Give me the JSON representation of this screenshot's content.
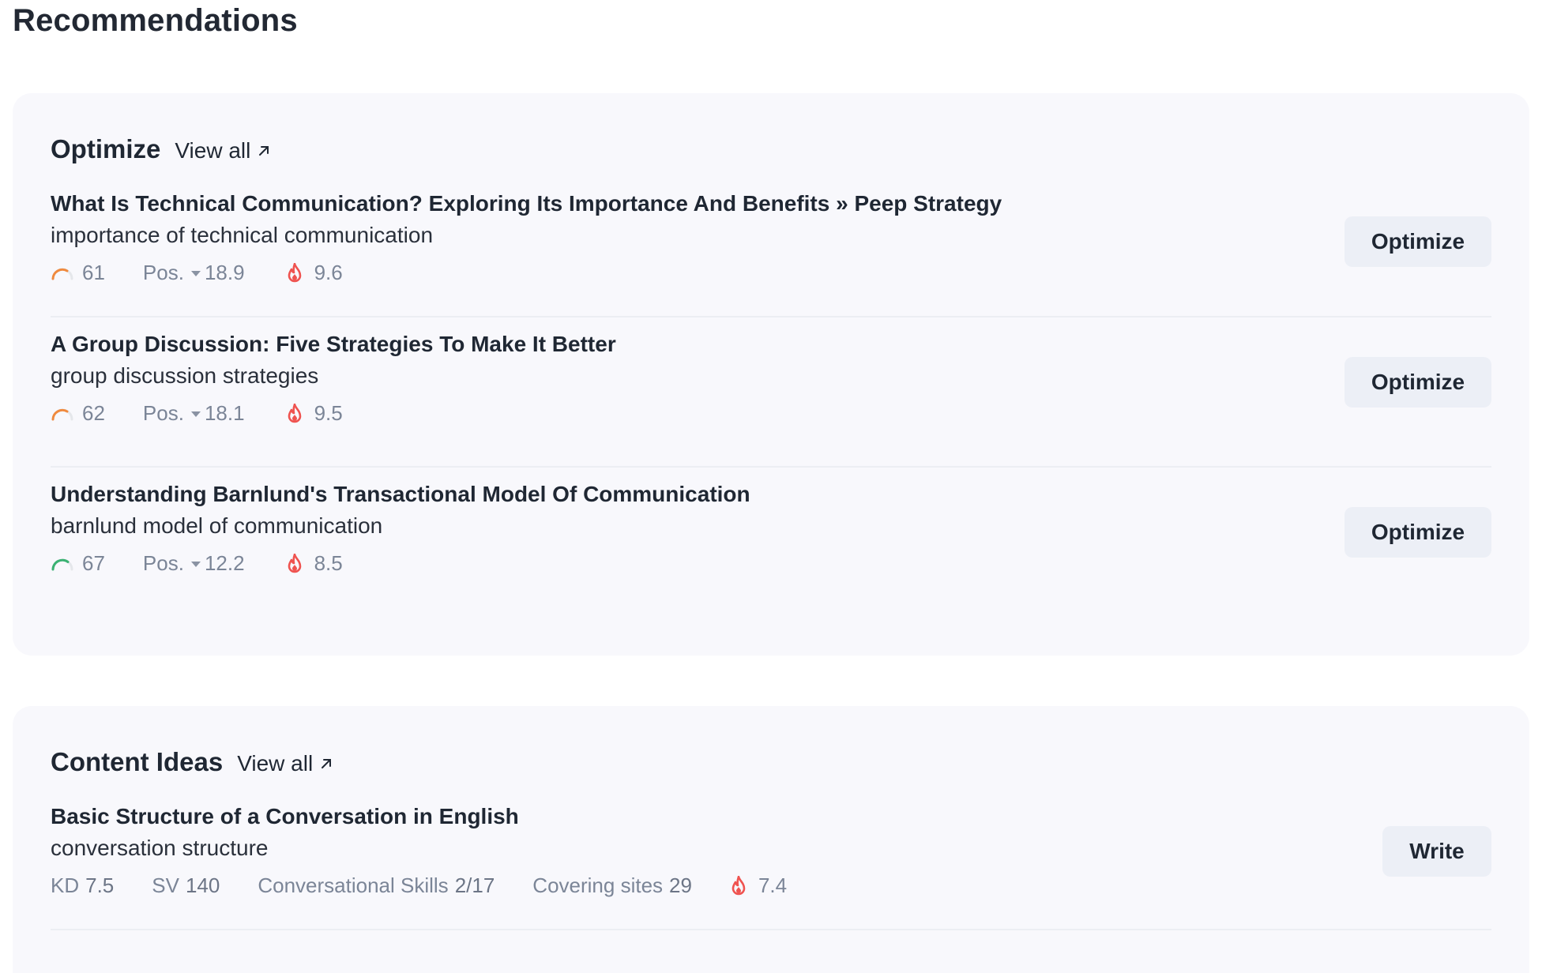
{
  "page": {
    "title": "Recommendations"
  },
  "optimize": {
    "title": "Optimize",
    "view_all": "View all",
    "items": [
      {
        "title": "What Is Technical Communication? Exploring Its Importance And Benefits » Peep Strategy",
        "keyword": "importance of technical communication",
        "score": "61",
        "pos_label": "Pos.",
        "pos_value": "18.9",
        "heat": "9.6",
        "gauge_color": "#f08a3e",
        "button": "Optimize"
      },
      {
        "title": "A Group Discussion: Five Strategies To Make It Better",
        "keyword": "group discussion strategies",
        "score": "62",
        "pos_label": "Pos.",
        "pos_value": "18.1",
        "heat": "9.5",
        "gauge_color": "#f08a3e",
        "button": "Optimize"
      },
      {
        "title": "Understanding Barnlund's Transactional Model Of Communication",
        "keyword": "barnlund model of communication",
        "score": "67",
        "pos_label": "Pos.",
        "pos_value": "12.2",
        "heat": "8.5",
        "gauge_color": "#3bb273",
        "button": "Optimize"
      }
    ]
  },
  "content_ideas": {
    "title": "Content Ideas",
    "view_all": "View all",
    "items": [
      {
        "title": "Basic Structure of a Conversation in English",
        "keyword": "conversation structure",
        "kd_label": "KD",
        "kd_value": "7.5",
        "sv_label": "SV",
        "sv_value": "140",
        "topic_label": "Conversational Skills",
        "topic_value": "2/17",
        "covering_label": "Covering sites",
        "covering_value": "29",
        "heat": "7.4",
        "button": "Write"
      }
    ]
  },
  "colors": {
    "fire": "#ef5350",
    "card_bg": "#f8f8fc",
    "button_bg": "#eceff6"
  }
}
